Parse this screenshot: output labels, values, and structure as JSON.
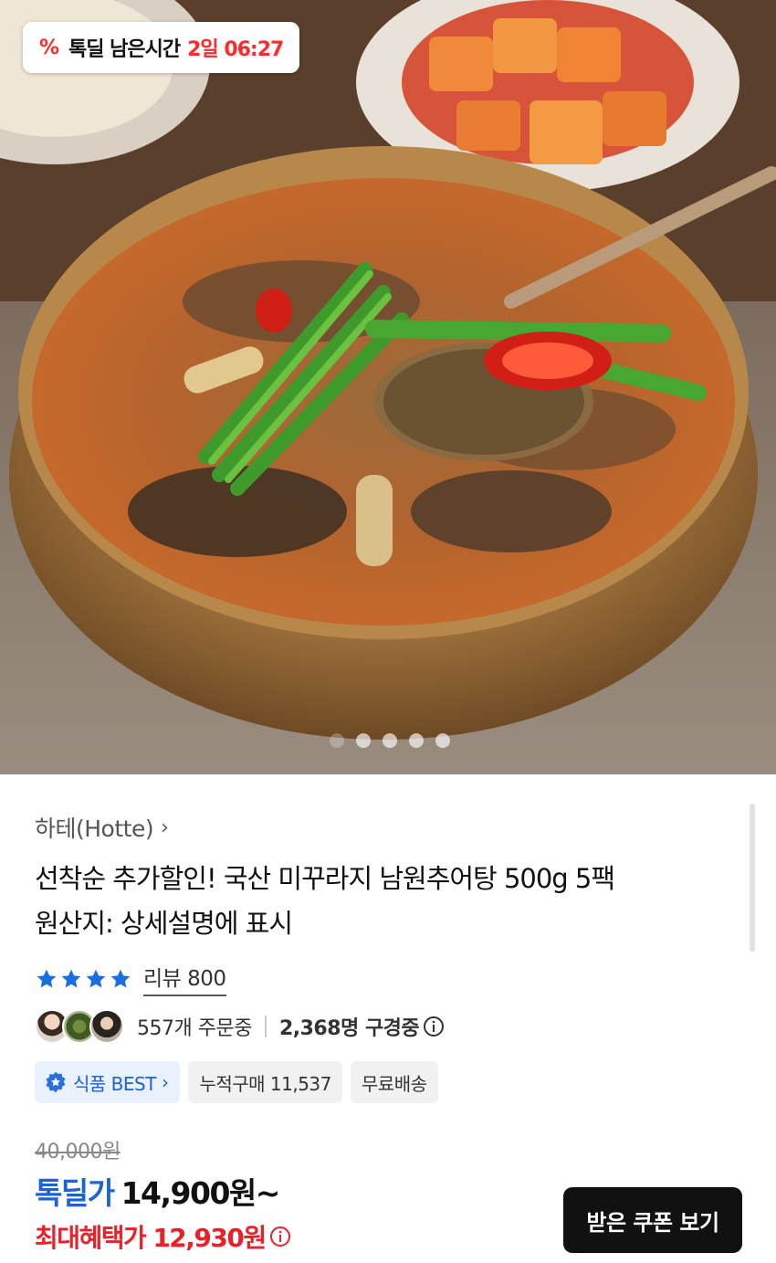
{
  "deal_badge": {
    "icon": "percent-tag-icon",
    "label": "톡딜 남은시간",
    "time_left": "2일 06:27"
  },
  "image_carousel": {
    "slide_count": 5,
    "active_index": 0
  },
  "product": {
    "brand": "하테(Hotte)",
    "title_line1": "선착순 추가할인! 국산 미꾸라지 남원추어탕 500g 5팩",
    "title_line2": "원산지: 상세설명에 표시"
  },
  "rating": {
    "stars": 4,
    "review_label": "리뷰 800"
  },
  "activity": {
    "orders": "557개 주문중",
    "browsing": "2,368명 구경중"
  },
  "chips": {
    "best": "식품 BEST",
    "cumulative": "누적구매 11,537",
    "shipping": "무료배송"
  },
  "pricing": {
    "original": "40,000원",
    "deal_label": "톡딜가",
    "deal_value": "14,900원~",
    "max_label": "최대혜택가",
    "max_value": "12,930원"
  },
  "coupon_button": "받은 쿠폰 보기",
  "colors": {
    "accent_blue": "#1a63d8",
    "accent_red": "#e8212b",
    "timer_red": "#ff2b2b",
    "button_dark": "#111111"
  }
}
